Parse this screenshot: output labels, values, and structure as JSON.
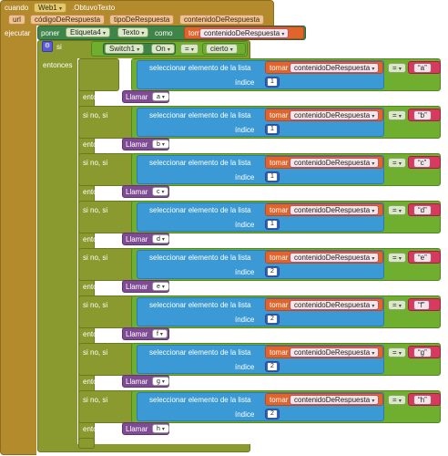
{
  "event": {
    "cuando": "cuando",
    "component": "Web1",
    "event_name": ".ObtuvoTexto",
    "params": [
      "url",
      "códigoDeRespuesta",
      "tipoDeRespuesta",
      "contenidoDeRespuesta"
    ],
    "ejecutar": "ejecutar"
  },
  "setter": {
    "poner": "poner",
    "component": "Etiqueta4",
    "property": "Texto",
    "como": "como",
    "tomar": "tomar",
    "var": "contenidoDeRespuesta"
  },
  "outer_if": {
    "si": "si",
    "entonces": "entonces",
    "component": "Switch1",
    "property": "On",
    "op": "=",
    "value": "cierto"
  },
  "inner_if": {
    "si": "si",
    "select_label": "seleccionar elemento de la lista",
    "indice_label": "índice",
    "tomar": "tomar",
    "var": "contenidoDeRespuesta",
    "op": "=",
    "entonces": "entonces",
    "sino_si": "si no, si",
    "llamar": "Llamar",
    "branches": [
      {
        "index": "1",
        "match": "a",
        "call": "a"
      },
      {
        "index": "1",
        "match": "b",
        "call": "b"
      },
      {
        "index": "1",
        "match": "c",
        "call": "c"
      },
      {
        "index": "1",
        "match": "d",
        "call": "d"
      },
      {
        "index": "2",
        "match": "e",
        "call": "e"
      },
      {
        "index": "2",
        "match": "f",
        "call": "f"
      },
      {
        "index": "2",
        "match": "g",
        "call": "g"
      },
      {
        "index": "2",
        "match": "h",
        "call": "h"
      }
    ]
  },
  "caret": "▾"
}
